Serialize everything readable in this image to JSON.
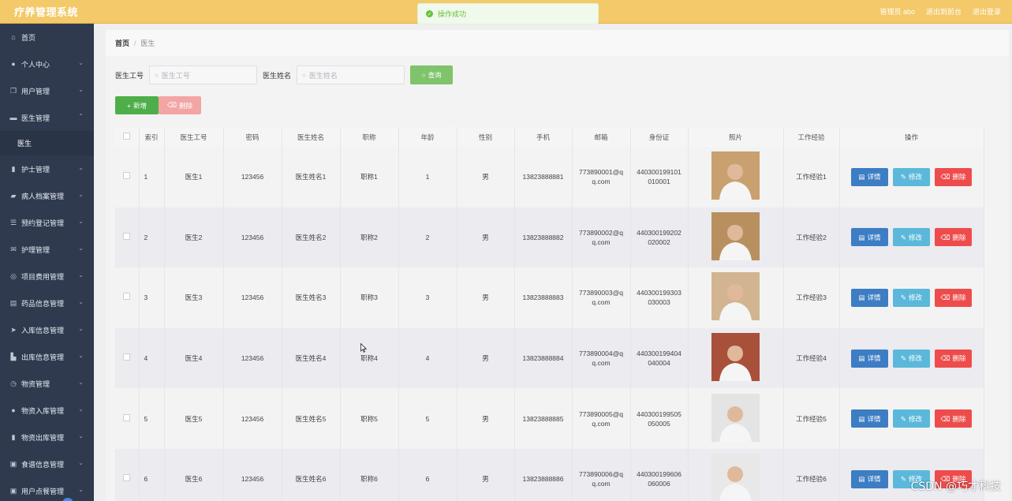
{
  "app": {
    "title": "疗养管理系统"
  },
  "topbar": {
    "user": "管理员 abo",
    "back": "退出到前台",
    "logout": "退出登录"
  },
  "toast": {
    "message": "操作成功"
  },
  "sidebar": {
    "items": [
      {
        "label": "首页",
        "icon": "home-icon"
      },
      {
        "label": "个人中心",
        "icon": "user-icon"
      },
      {
        "label": "用户管理",
        "icon": "copy-icon"
      },
      {
        "label": "医生管理",
        "icon": "monitor-icon"
      },
      {
        "label": "护士管理",
        "icon": "book-icon"
      },
      {
        "label": "病人档案管理",
        "icon": "folder-icon"
      },
      {
        "label": "预约登记管理",
        "icon": "list-icon"
      },
      {
        "label": "护理管理",
        "icon": "mail-icon"
      },
      {
        "label": "项目费用管理",
        "icon": "globe-icon"
      },
      {
        "label": "药品信息管理",
        "icon": "medicine-icon"
      },
      {
        "label": "入库信息管理",
        "icon": "send-icon"
      },
      {
        "label": "出库信息管理",
        "icon": "chart-icon"
      },
      {
        "label": "物资管理",
        "icon": "clock-icon"
      },
      {
        "label": "物资入库管理",
        "icon": "user-icon"
      },
      {
        "label": "物资出库管理",
        "icon": "bar-icon"
      },
      {
        "label": "食谱信息管理",
        "icon": "clipboard-icon"
      },
      {
        "label": "用户点餐管理",
        "icon": "bag-icon"
      }
    ],
    "sub_item": "医生"
  },
  "breadcrumb": {
    "home": "首页",
    "sep": "/",
    "current": "医生"
  },
  "search": {
    "label_id": "医生工号",
    "placeholder_id": "医生工号",
    "label_name": "医生姓名",
    "placeholder_name": "医生姓名",
    "query": "查询"
  },
  "actions": {
    "add": "新增",
    "delete": "删除"
  },
  "table": {
    "headers": [
      "索引",
      "医生工号",
      "密码",
      "医生姓名",
      "职称",
      "年龄",
      "性别",
      "手机",
      "邮箱",
      "身份证",
      "照片",
      "工作经验",
      "操作"
    ],
    "buttons": {
      "detail": "详情",
      "edit": "修改",
      "remove": "删除"
    },
    "rows": [
      {
        "index": "1",
        "id": "医生1",
        "password": "123456",
        "name": "医生姓名1",
        "title": "职称1",
        "age": "1",
        "gender": "男",
        "phone": "13823888881",
        "email_a": "773890001@q",
        "email_b": "q.com",
        "idcard_a": "440300199101",
        "idcard_b": "010001",
        "exp": "工作经验1"
      },
      {
        "index": "2",
        "id": "医生2",
        "password": "123456",
        "name": "医生姓名2",
        "title": "职称2",
        "age": "2",
        "gender": "男",
        "phone": "13823888882",
        "email_a": "773890002@q",
        "email_b": "q.com",
        "idcard_a": "440300199202",
        "idcard_b": "020002",
        "exp": "工作经验2"
      },
      {
        "index": "3",
        "id": "医生3",
        "password": "123456",
        "name": "医生姓名3",
        "title": "职称3",
        "age": "3",
        "gender": "男",
        "phone": "13823888883",
        "email_a": "773890003@q",
        "email_b": "q.com",
        "idcard_a": "440300199303",
        "idcard_b": "030003",
        "exp": "工作经验3"
      },
      {
        "index": "4",
        "id": "医生4",
        "password": "123456",
        "name": "医生姓名4",
        "title": "职称4",
        "age": "4",
        "gender": "男",
        "phone": "13823888884",
        "email_a": "773890004@q",
        "email_b": "q.com",
        "idcard_a": "440300199404",
        "idcard_b": "040004",
        "exp": "工作经验4"
      },
      {
        "index": "5",
        "id": "医生5",
        "password": "123456",
        "name": "医生姓名5",
        "title": "职称5",
        "age": "5",
        "gender": "男",
        "phone": "13823888885",
        "email_a": "773890005@q",
        "email_b": "q.com",
        "idcard_a": "440300199505",
        "idcard_b": "050005",
        "exp": "工作经验5"
      },
      {
        "index": "6",
        "id": "医生6",
        "password": "123456",
        "name": "医生姓名6",
        "title": "职称6",
        "age": "6",
        "gender": "男",
        "phone": "13823888886",
        "email_a": "773890006@q",
        "email_b": "q.com",
        "idcard_a": "440300199606",
        "idcard_b": "060006",
        "exp": "工作经验6"
      }
    ]
  },
  "watermark": "CSDN @巧才科技"
}
